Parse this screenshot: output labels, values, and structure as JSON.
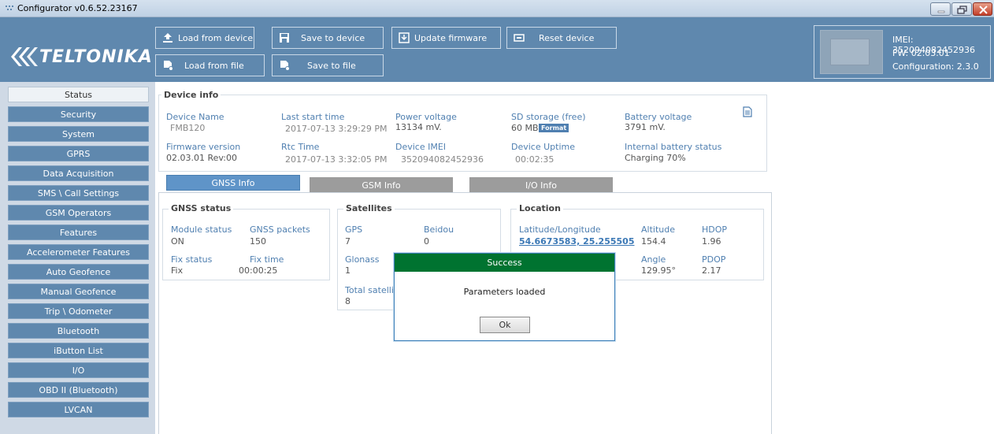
{
  "window": {
    "title": "Configurator v0.6.52.23167"
  },
  "header": {
    "logo_text": "TELTONIKA",
    "buttons": {
      "load_from_device": "Load from device",
      "save_to_device": "Save to device",
      "update_firmware": "Update firmware",
      "reset_device": "Reset device",
      "load_from_file": "Load from file",
      "save_to_file": "Save to file"
    },
    "device": {
      "imei": "IMEI: 352094082452936",
      "fw": "FW: 02.03.01",
      "configuration": "Configuration: 2.3.0"
    }
  },
  "sidebar": {
    "items": [
      {
        "label": "Status"
      },
      {
        "label": "Security"
      },
      {
        "label": "System"
      },
      {
        "label": "GPRS"
      },
      {
        "label": "Data Acquisition"
      },
      {
        "label": "SMS \\ Call Settings"
      },
      {
        "label": "GSM Operators"
      },
      {
        "label": "Features"
      },
      {
        "label": "Accelerometer Features"
      },
      {
        "label": "Auto Geofence"
      },
      {
        "label": "Manual Geofence"
      },
      {
        "label": "Trip \\ Odometer"
      },
      {
        "label": "Bluetooth"
      },
      {
        "label": "iButton List"
      },
      {
        "label": "I/O"
      },
      {
        "label": "OBD II (Bluetooth)"
      },
      {
        "label": "LVCAN"
      }
    ]
  },
  "device_info": {
    "legend": "Device info",
    "device_name_label": "Device Name",
    "device_name": "FMB120",
    "last_start_label": "Last start time",
    "last_start": "2017-07-13 3:29:29 PM",
    "power_voltage_label": "Power voltage",
    "power_voltage": "13134 mV.",
    "sd_storage_label": "SD storage (free)",
    "sd_storage": "60 MB",
    "format_label": "Format",
    "battery_voltage_label": "Battery voltage",
    "battery_voltage": "3791 mV.",
    "firmware_label": "Firmware version",
    "firmware": "02.03.01 Rev:00",
    "rtc_label": "Rtc Time",
    "rtc": "2017-07-13 3:32:05 PM",
    "imei_label": "Device IMEI",
    "imei": "352094082452936",
    "uptime_label": "Device Uptime",
    "uptime": "00:02:35",
    "internal_battery_label": "Internal battery status",
    "internal_battery": "Charging 70%"
  },
  "tabs": {
    "gnss": "GNSS Info",
    "gsm": "GSM Info",
    "io": "I/O Info"
  },
  "gnss_status": {
    "legend": "GNSS status",
    "module_status_label": "Module status",
    "module_status": "ON",
    "gnss_packets_label": "GNSS packets",
    "gnss_packets": "150",
    "fix_status_label": "Fix status",
    "fix_status": "Fix",
    "fix_time_label": "Fix time",
    "fix_time": "00:00:25"
  },
  "satellites": {
    "legend": "Satellites",
    "gps_label": "GPS",
    "gps": "7",
    "beidou_label": "Beidou",
    "beidou": "0",
    "glonass_label": "Glonass",
    "glonass": "1",
    "total_label": "Total satellit",
    "total": "8"
  },
  "location": {
    "legend": "Location",
    "latlon_label": "Latitude/Longitude",
    "latlon": "54.6673583, 25.255505",
    "altitude_label": "Altitude",
    "altitude": "154.4",
    "hdop_label": "HDOP",
    "hdop": "1.96",
    "angle_label": "Angle",
    "angle": "129.95°",
    "pdop_label": "PDOP",
    "pdop": "2.17"
  },
  "dialog": {
    "title": "Success",
    "message": "Parameters loaded",
    "ok": "Ok"
  }
}
